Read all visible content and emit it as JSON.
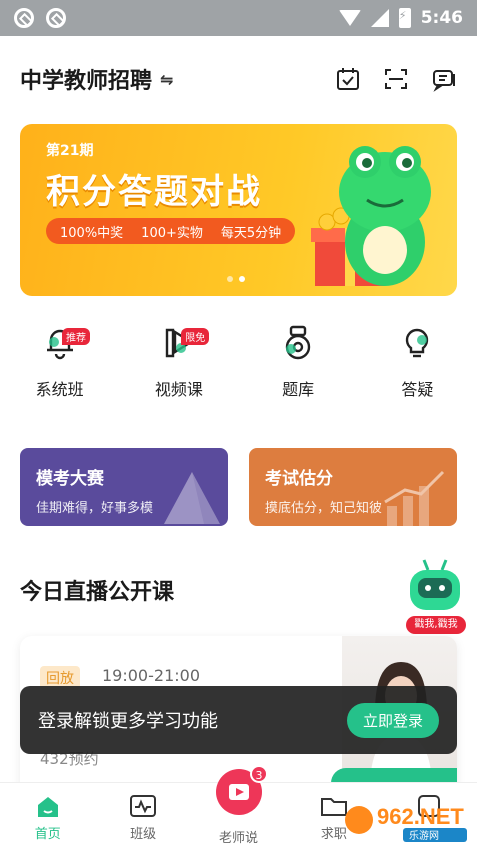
{
  "status_bar": {
    "time": "5:46"
  },
  "header": {
    "title": "中学教师招聘",
    "switch_glyph": "⇋",
    "icons": [
      "calendar-check-icon",
      "scan-icon",
      "message-icon"
    ]
  },
  "banner": {
    "issue": "第21期",
    "headline": "积分答题对战",
    "tags": [
      "100%中奖",
      "100+实物",
      "每天5分钟"
    ],
    "page_count": 2,
    "active_page": 2
  },
  "categories": [
    {
      "label": "系统班",
      "badge": "推荐",
      "icon": "bell-icon"
    },
    {
      "label": "视频课",
      "badge": "限免",
      "icon": "play-icon"
    },
    {
      "label": "题库",
      "badge": "",
      "icon": "question-bank-icon"
    },
    {
      "label": "答疑",
      "badge": "",
      "icon": "lightbulb-icon"
    }
  ],
  "feature_cards": [
    {
      "title": "模考大赛",
      "subtitle": "佳期难得，好事多模",
      "color": "#5a4b9c"
    },
    {
      "title": "考试估分",
      "subtitle": "摸底估分，知己知彼",
      "color": "#dd7d3f"
    }
  ],
  "live": {
    "section_title": "今日直播公开课",
    "mascot_label": "戳我,戳我",
    "card": {
      "tag": "回放",
      "time": "19:00-21:00",
      "count": "432预约"
    }
  },
  "toast": {
    "text": "登录解锁更多学习功能",
    "button": "立即登录"
  },
  "bottom_nav": [
    {
      "label": "首页",
      "active": true
    },
    {
      "label": "班级",
      "active": false
    },
    {
      "label": "老师说",
      "active": false,
      "badge": "3"
    },
    {
      "label": "求职",
      "active": false
    },
    {
      "label": "",
      "active": false
    }
  ],
  "watermark": {
    "text": "962.NET",
    "subtext": "乐游网"
  },
  "colors": {
    "accent": "#25c18a",
    "banner": "#ffc927",
    "badge": "#e8263a"
  }
}
